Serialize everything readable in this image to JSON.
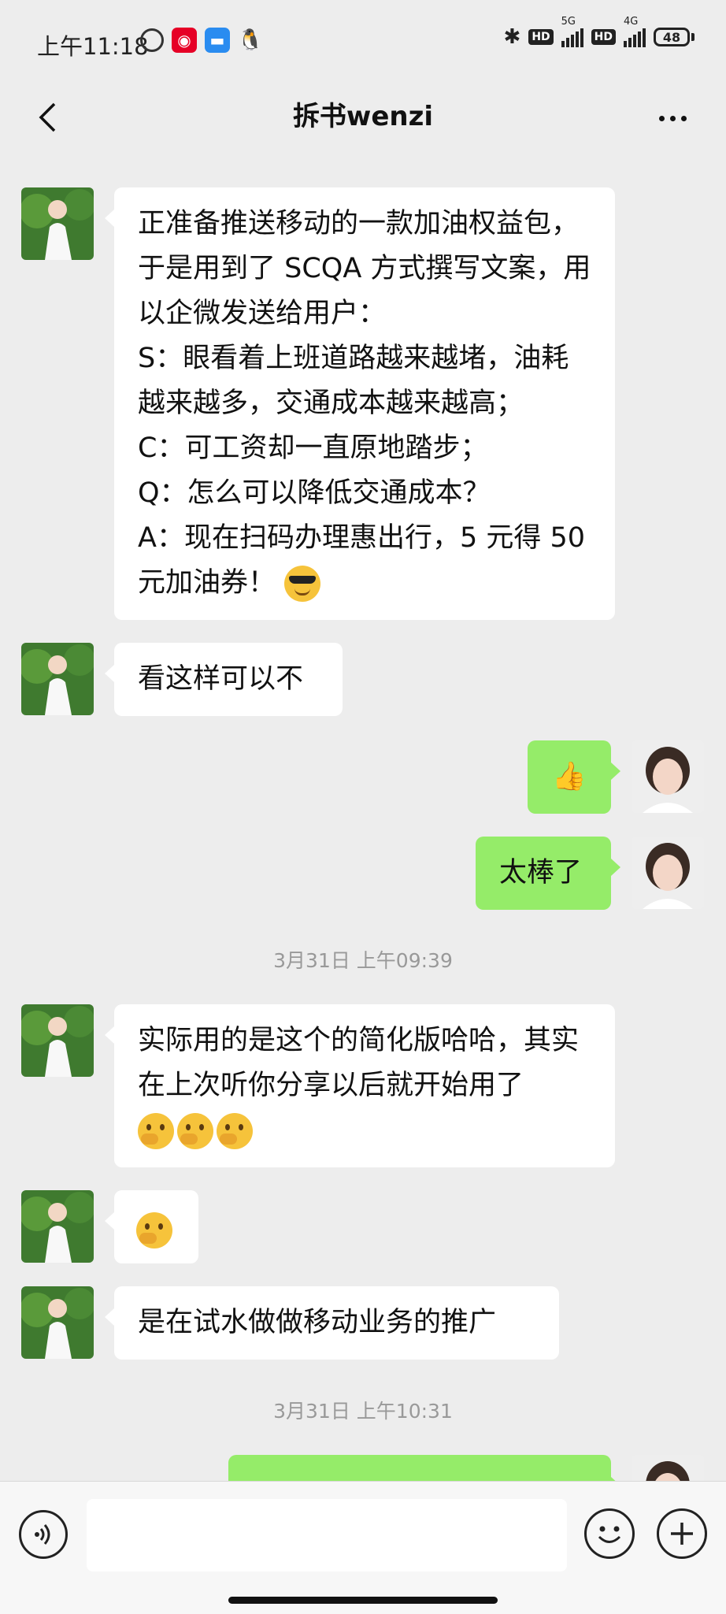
{
  "status_bar": {
    "time": "上午11:18",
    "network_5g": "5G",
    "network_4g": "4G",
    "hd_label": "HD",
    "battery": "48"
  },
  "header": {
    "title": "拆书wenzi"
  },
  "messages": [
    {
      "side": "in",
      "text": "正准备推送移动的一款加油权益包，于是用到了 SCQA 方式撰写文案，用以企微发送给用户：\nS：眼看着上班道路越来越堵，油耗越来越多，交通成本越来越高；\nC：可工资却一直原地踏步；\nQ：怎么可以降低交通成本？\nA：现在扫码办理惠出行，5 元得 50 元加油券！",
      "emoji": "sunglasses"
    },
    {
      "side": "in",
      "text": "看这样可以不"
    },
    {
      "side": "out",
      "text": "👍"
    },
    {
      "side": "out",
      "text": "太棒了"
    },
    {
      "side": "in",
      "text": "实际用的是这个的简化版哈哈，其实在上次听你分享以后就开始用了",
      "emoji": "thinking x3"
    },
    {
      "side": "in",
      "text": "",
      "emoji": "thinking"
    },
    {
      "side": "in",
      "text": "是在试水做做移动业务的推广"
    }
  ],
  "timestamps": [
    "3月31日 上午09:39",
    "3月31日 上午10:31"
  ],
  "input": {
    "value": "",
    "placeholder": ""
  },
  "colors": {
    "background": "#ededed",
    "outgoing_bubble": "#95ec69",
    "incoming_bubble": "#ffffff"
  }
}
